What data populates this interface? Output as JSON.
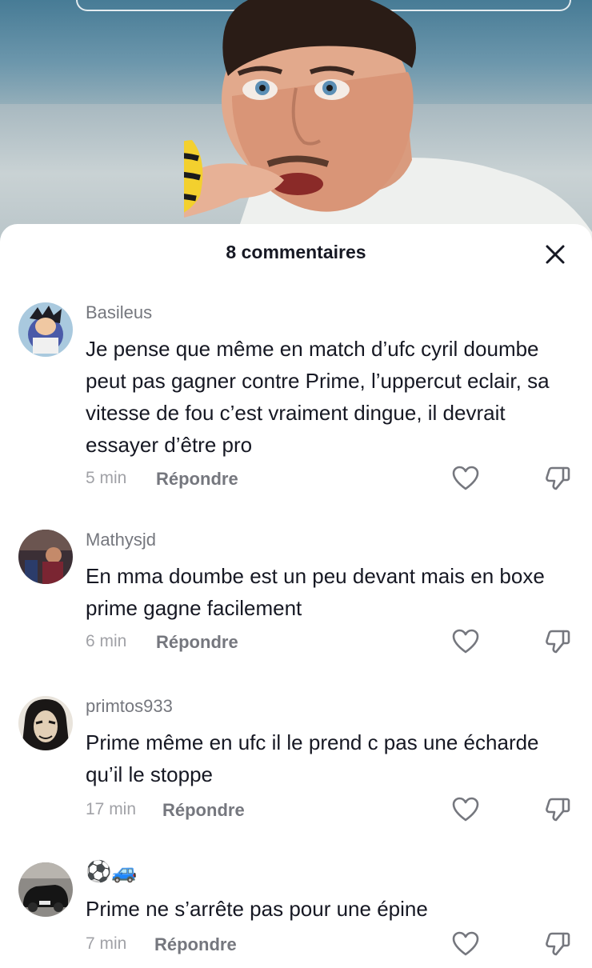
{
  "sheet": {
    "title": "8 commentaires"
  },
  "comments": [
    {
      "username": "Basileus",
      "text": "Je pense que même en match d’ufc cyril doumbe peut pas gagner contre Prime, l’uppercut eclair, sa vitesse de fou c’est vraiment dingue, il devrait essayer d’être pro",
      "time": "5 min",
      "reply": "Répondre"
    },
    {
      "username": "Mathysjd",
      "text": "En mma doumbe est un peu devant mais en boxe prime gagne facilement",
      "time": "6 min",
      "reply": "Répondre"
    },
    {
      "username": "primtos933",
      "text": "Prime même en ufc il le prend c pas une écharde qu’il le stoppe",
      "time": "17 min",
      "reply": "Répondre"
    },
    {
      "username": "⚽🚙",
      "text": "Prime ne s’arrête pas pour une épine",
      "time": "7 min",
      "reply": "Répondre"
    }
  ],
  "icons": {
    "close": "close-icon",
    "like": "heart-outline-icon",
    "dislike": "thumbs-down-icon"
  },
  "colors": {
    "text_primary": "#161823",
    "text_secondary": "#75777e",
    "text_tertiary": "#a1a2a7"
  }
}
